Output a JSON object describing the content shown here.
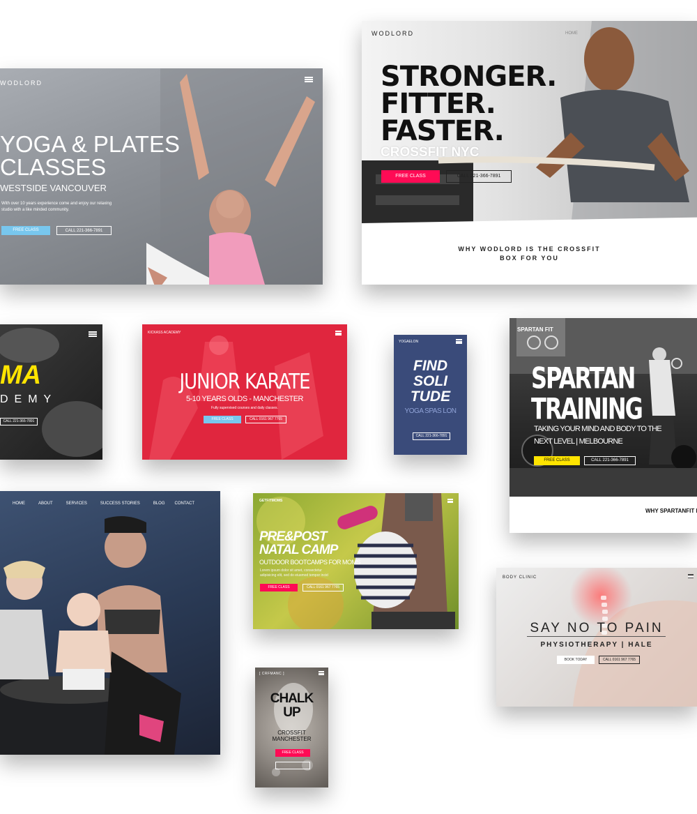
{
  "colors": {
    "pink": "#ff0b55",
    "yellow": "#ffe400",
    "light_blue": "#78c7ee"
  },
  "yoga": {
    "logo": "WODLORD",
    "title1": "YOGA & PLATES",
    "title2": "CLASSES",
    "location": "WESTSIDE VANCOUVER",
    "desc": "With over 10 years experience come and enjoy our relaxing studio with a like minded community.",
    "cta_primary": "FREE CLASS",
    "cta_secondary": "CALL 221-366-7891"
  },
  "crossfit": {
    "logo": "WODLORD",
    "nav": [
      "HOME"
    ],
    "line1": "STRONGER.",
    "line2": "FITTER.",
    "line3": "FASTER.",
    "subtitle": "CROSSFIT NYC",
    "cta_primary": "FREE CLASS",
    "cta_secondary": "CALL 221-366-7891",
    "why1": "WHY WODLORD IS THE CROSSFIT",
    "why2": "BOX FOR YOU"
  },
  "mma": {
    "title": "MA",
    "subtitle": "DEMY",
    "cta": "CALL 221-366-7891"
  },
  "karate": {
    "logo": "KICKASS ACADEMY",
    "title": "JUNIOR KARATE",
    "subtitle": "5-10 YEARS OLDS - MANCHESTER",
    "desc": "Fully supervised courses and daily classes.",
    "cta_primary": "FREE CLASS",
    "cta_secondary": "CALL 0161 967 7765"
  },
  "solitude": {
    "logo": "YOGAELON",
    "line1": "FIND",
    "line2": "SOLI",
    "line3": "TUDE",
    "subtitle": "YOGA SPAS LON",
    "cta": "CALL 221-366-7891"
  },
  "spartan": {
    "logo": "SPARTAN FIT",
    "line1": "SPARTAN",
    "line2": "TRAINING",
    "sub1": "TAKING YOUR MIND AND BODY TO THE",
    "sub2": "NEXT LEVEL | MELBOURNE",
    "cta_primary": "FREE CLASS",
    "cta_secondary": "CALL 221-366-7891",
    "why": "WHY SPARTANFIT IS"
  },
  "family": {
    "nav": [
      "HOME",
      "ABOUT",
      "SERVICES",
      "SUCCESS STORIES",
      "BLOG",
      "CONTACT"
    ]
  },
  "natal": {
    "logo": "GETFITMOMS",
    "line1": "PRE&POST",
    "line2": "NATAL CAMP",
    "subtitle": "OUTDOOR BOOTCAMPS FOR MOMS",
    "desc1": "Lorem ipsum dolor sit amet, consectetur",
    "desc2": "adipisicing elit, sed do eiusmod tempor incid",
    "cta_primary": "FREE CLASS",
    "cta_secondary": "CALL 0161 967 7765"
  },
  "clinic": {
    "logo": "BODY CLINIC",
    "title": "SAY NO TO PAIN",
    "subtitle": "PHYSIOTHERAPY | HALE",
    "cta_primary": "BOOK TODAY",
    "cta_secondary": "CALL 0161 967 7765"
  },
  "chalk": {
    "logo": "[ CRFMANC ]",
    "line1": "CHALK",
    "line2": "UP",
    "sub1": "CROSSFIT",
    "sub2": "MANCHESTER",
    "cta_primary": "FREE CLASS"
  }
}
